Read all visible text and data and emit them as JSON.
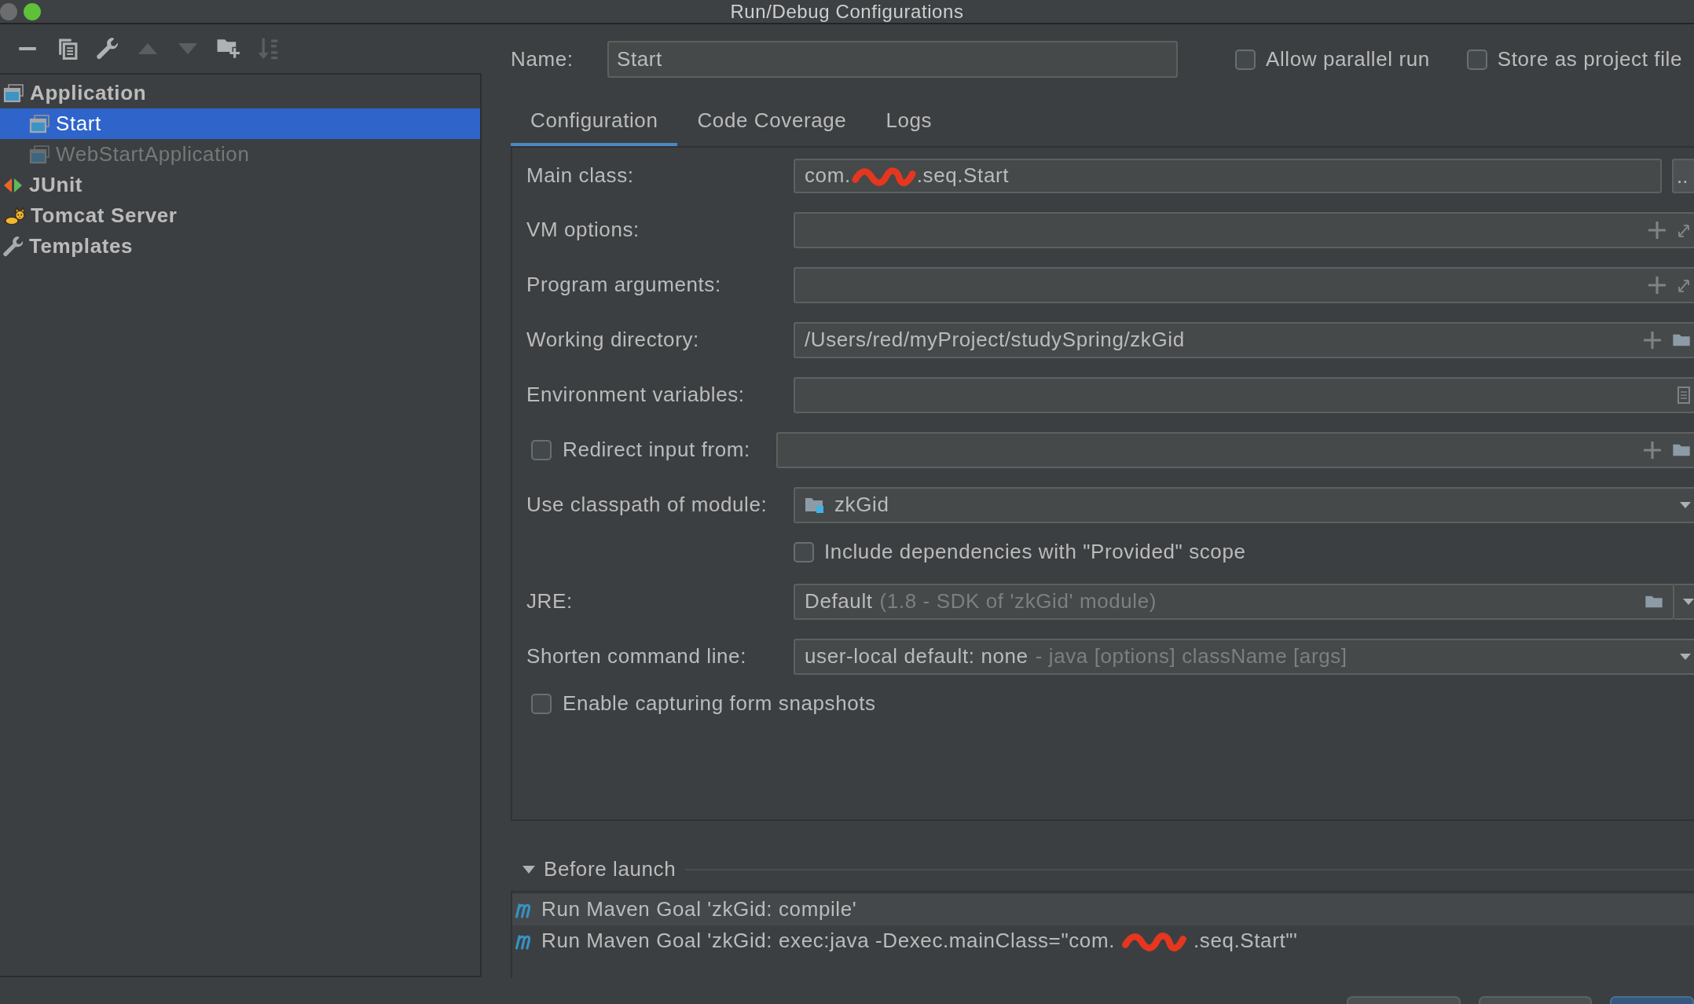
{
  "window": {
    "title": "Run/Debug Configurations"
  },
  "toolbar": [
    {
      "kind": "remove",
      "disabled": false
    },
    {
      "kind": "copy",
      "disabled": false
    },
    {
      "kind": "edit",
      "disabled": false
    },
    {
      "kind": "move-up",
      "disabled": true
    },
    {
      "kind": "move-down",
      "disabled": true
    },
    {
      "kind": "new-folder",
      "disabled": false
    },
    {
      "kind": "sort",
      "disabled": true
    }
  ],
  "tree": [
    {
      "label": "Application",
      "kind": "application",
      "selected": false,
      "disabled": false,
      "children": [
        {
          "label": "Start",
          "kind": "application",
          "selected": true,
          "disabled": false
        },
        {
          "label": "WebStartApplication",
          "kind": "application",
          "selected": false,
          "disabled": true
        }
      ]
    },
    {
      "label": "JUnit",
      "kind": "junit",
      "selected": false,
      "disabled": false
    },
    {
      "label": "Tomcat Server",
      "kind": "tomcat",
      "selected": false,
      "disabled": false
    },
    {
      "label": "Templates",
      "kind": "templates",
      "selected": false,
      "disabled": false
    }
  ],
  "name_field": {
    "label": "Name:",
    "value": "Start"
  },
  "options": [
    {
      "label": "Allow parallel run",
      "checked": false
    },
    {
      "label": "Store as project file",
      "checked": false
    }
  ],
  "tabs": [
    {
      "label": "Configuration",
      "selected": true
    },
    {
      "label": "Code Coverage",
      "selected": false
    },
    {
      "label": "Logs",
      "selected": false
    }
  ],
  "form": [
    {
      "kind": "class",
      "label": "Main class:",
      "segments": [
        {
          "kind": "text",
          "text": "com."
        },
        {
          "kind": "redaction"
        },
        {
          "kind": "text",
          "text": ".seq.Start"
        }
      ],
      "button": ".."
    },
    {
      "kind": "expandable",
      "label": "VM options:"
    },
    {
      "kind": "expandable",
      "label": "Program arguments:"
    },
    {
      "kind": "directory",
      "label": "Working directory:",
      "value": "/Users/red/myProject/studySpring/zkGid"
    },
    {
      "kind": "environment",
      "label": "Environment variables:"
    },
    {
      "kind": "redirect",
      "label": "Redirect input from:",
      "checked": false
    },
    {
      "kind": "module",
      "label": "Use classpath of module:",
      "value": "zkGid",
      "option": {
        "label": "Include dependencies with \"Provided\" scope",
        "checked": false
      }
    },
    {
      "kind": "jre",
      "label": "JRE:",
      "value": "Default",
      "hint": "(1.8 - SDK of 'zkGid' module)"
    },
    {
      "kind": "combo",
      "label": "Shorten command line:",
      "value": "user-local default: none",
      "hint": "- java [options] className [args]"
    },
    {
      "kind": "checkbox",
      "label": "Enable capturing form snapshots",
      "checked": false
    }
  ],
  "before_launch": {
    "title": "Before launch",
    "expanded": true,
    "tasks": [
      {
        "selected": true,
        "segments": [
          {
            "kind": "text",
            "text": "Run Maven Goal 'zkGid: compile'"
          }
        ]
      },
      {
        "selected": false,
        "segments": [
          {
            "kind": "text",
            "text": "Run Maven Goal 'zkGid: exec:java -Dexec.mainClass=\"com."
          },
          {
            "kind": "redaction"
          },
          {
            "kind": "text",
            "text": ".seq.Start\"'"
          }
        ]
      }
    ]
  },
  "footer_buttons": [
    {
      "kind": "default"
    },
    {
      "kind": "default"
    },
    {
      "kind": "primary"
    }
  ]
}
